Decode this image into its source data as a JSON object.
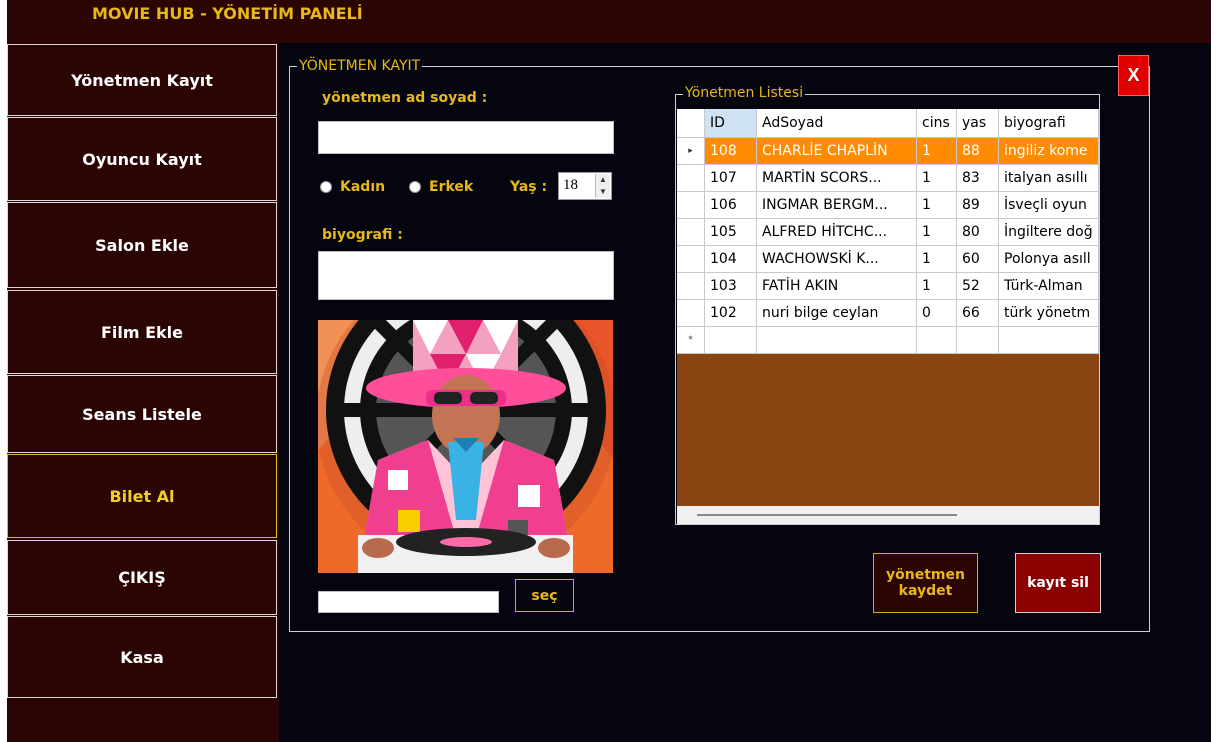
{
  "app": {
    "title": "MOVIE HUB - YÖNETİM PANELİ"
  },
  "sidebar": {
    "items": [
      {
        "label": "Yönetmen Kayıt"
      },
      {
        "label": "Oyuncu Kayıt"
      },
      {
        "label": "Salon Ekle"
      },
      {
        "label": "Film Ekle"
      },
      {
        "label": "Seans Listele"
      },
      {
        "label": "Bilet Al"
      },
      {
        "label": "ÇIKIŞ"
      },
      {
        "label": "Kasa"
      }
    ]
  },
  "form": {
    "group_title": "YÖNETMEN KAYIT",
    "name_label": "yönetmen ad soyad :",
    "name_value": "",
    "gender_female": "Kadın",
    "gender_male": "Erkek",
    "age_label": "Yaş :",
    "age_value": "18",
    "bio_label": "biyografi :",
    "bio_value": "",
    "file_value": "",
    "select_button": "seç"
  },
  "list": {
    "group_title": "Yönetmen Listesi",
    "columns": [
      "ID",
      "AdSoyad",
      "cins",
      "yas",
      "biyografi"
    ],
    "rows": [
      [
        "108",
        "CHARLİE CHAPLİN",
        "1",
        "88",
        "ingiliz kome"
      ],
      [
        "107",
        "MARTİN SCORS...",
        "1",
        "83",
        "italyan asıllı"
      ],
      [
        "106",
        "INGMAR BERGM...",
        "1",
        "89",
        "İsveçli oyun"
      ],
      [
        "105",
        "ALFRED HİTCHC...",
        "1",
        "80",
        "İngiltere doğ"
      ],
      [
        "104",
        "WACHOWSKİ K...",
        "1",
        "60",
        "Polonya asıll"
      ],
      [
        "103",
        "FATİH AKIN",
        "1",
        "52",
        "Türk-Alman"
      ],
      [
        "102",
        "nuri bilge  ceylan",
        "0",
        "66",
        "türk yönetm"
      ]
    ],
    "selected_row": 0,
    "new_row_marker": "*",
    "current_row_marker": "▸"
  },
  "actions": {
    "save_label": "yönetmen kaydet",
    "delete_label": "kayıt sil",
    "close_label": "X"
  },
  "colors": {
    "background": "#05050f",
    "sidebar": "#2b0404",
    "accent": "#e8b818",
    "selected_row": "#ff8c00",
    "grid_background": "#8b4513",
    "delete_button": "#8b0000",
    "close_button": "#e00000"
  }
}
